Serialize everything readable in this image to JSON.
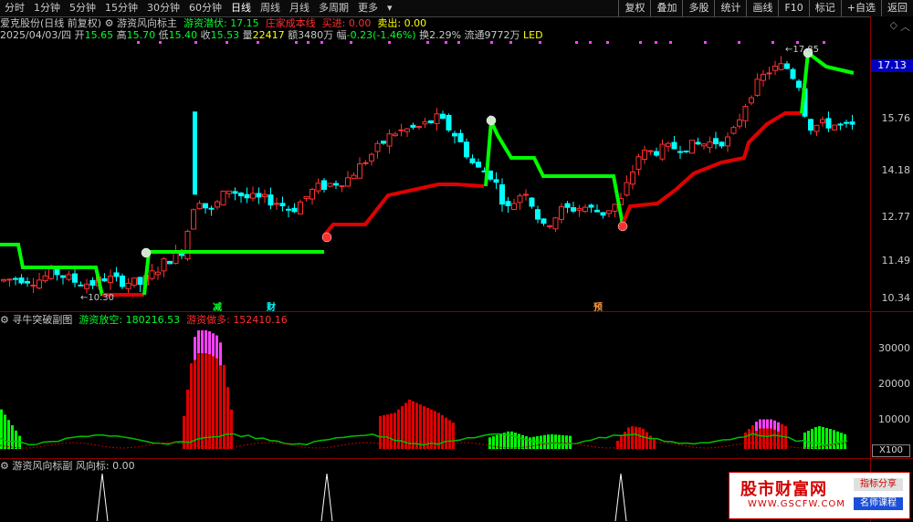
{
  "toolbar": {
    "timeframes": [
      "分时",
      "1分钟",
      "5分钟",
      "15分钟",
      "30分钟",
      "60分钟",
      "日线",
      "周线",
      "月线",
      "多周期",
      "更多"
    ],
    "active_timeframe": "日线",
    "buttons": [
      "复权",
      "叠加",
      "多股",
      "统计",
      "画线",
      "F10",
      "标记",
      "+自选",
      "返回"
    ]
  },
  "main_chart": {
    "stock_title": "爱克股份(日线 前复权)",
    "indicator_name": "游资风向标主",
    "lurk_label": "游资潜伏:",
    "lurk_value": "17.15",
    "cost_label": "庄家成本线",
    "buy_label": "买进:",
    "buy_value": "0.00",
    "sell_label": "卖出:",
    "sell_value": "0.00",
    "ohlc_line": {
      "date": "2025/04/03/四",
      "open_label": "开",
      "open": "15.65",
      "high_label": "高",
      "high": "15.70",
      "low_label": "低",
      "low": "15.40",
      "close_label": "收",
      "close": "15.53",
      "vol_label": "量",
      "vol": "22417",
      "amount_label": "额",
      "amount": "3480万",
      "change_label": "幅",
      "change": "-0.23(-1.46%)",
      "turnover_label": "换",
      "turnover": "2.29%",
      "float_label": "流通",
      "float": "9772万",
      "extra": "LED"
    },
    "price_axis": [
      "15.76",
      "14.18",
      "12.77",
      "11.49",
      "10.34"
    ],
    "current_price": "17.13",
    "low_marker": "←10.30",
    "high_marker": "←17.85",
    "event_tags": [
      "减",
      "财",
      "预"
    ]
  },
  "sub_chart1": {
    "name": "寻牛突破副图",
    "short_label": "游资放空:",
    "short_value": "180216.53",
    "long_label": "游资做多:",
    "long_value": "152410.16",
    "axis": [
      "30000",
      "20000",
      "10000"
    ],
    "scale_label": "X100"
  },
  "sub_chart2": {
    "name": "游资风向标副",
    "indicator_label": "风向标:",
    "indicator_value": "0.00"
  },
  "watermark": {
    "title": "股市财富网",
    "url": "WWW.GSCFW.COM",
    "badge1": "指标分享",
    "badge2": "名师课程"
  },
  "colors": {
    "up": "#ff3030",
    "down": "#00ffff",
    "trend_up": "#e00000",
    "trend_down": "#00ff00",
    "bg": "#000000"
  }
}
